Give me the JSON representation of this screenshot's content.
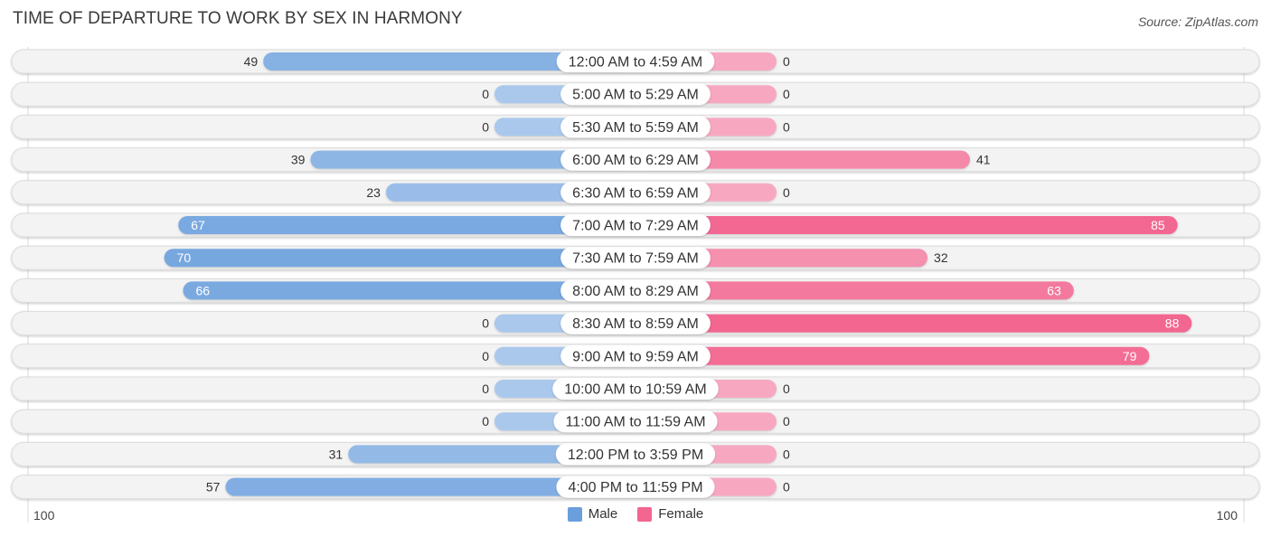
{
  "header": {
    "title": "TIME OF DEPARTURE TO WORK BY SEX IN HARMONY",
    "source": "Source: ZipAtlas.com"
  },
  "colors": {
    "male_strong": "#6a9fdc",
    "male_light": "#aac8ec",
    "female_strong": "#f26690",
    "female_light": "#f7a8c0",
    "row_bg": "#f3f3f3",
    "row_border": "#dcdcdc"
  },
  "legend": {
    "male_label": "Male",
    "female_label": "Female"
  },
  "axis": {
    "left_label": "100",
    "right_label": "100"
  },
  "chart_data": {
    "type": "bar",
    "orientation": "horizontal-diverging",
    "title": "TIME OF DEPARTURE TO WORK BY SEX IN HARMONY",
    "xlabel": "",
    "ylabel": "",
    "xlim": [
      0,
      100
    ],
    "legend_position": "bottom-center",
    "categories": [
      "12:00 AM to 4:59 AM",
      "5:00 AM to 5:29 AM",
      "5:30 AM to 5:59 AM",
      "6:00 AM to 6:29 AM",
      "6:30 AM to 6:59 AM",
      "7:00 AM to 7:29 AM",
      "7:30 AM to 7:59 AM",
      "8:00 AM to 8:29 AM",
      "8:30 AM to 8:59 AM",
      "9:00 AM to 9:59 AM",
      "10:00 AM to 10:59 AM",
      "11:00 AM to 11:59 AM",
      "12:00 PM to 3:59 PM",
      "4:00 PM to 11:59 PM"
    ],
    "series": [
      {
        "name": "Male",
        "values": [
          49,
          0,
          0,
          39,
          23,
          67,
          70,
          66,
          0,
          0,
          0,
          0,
          31,
          57
        ]
      },
      {
        "name": "Female",
        "values": [
          0,
          0,
          0,
          41,
          0,
          85,
          32,
          63,
          88,
          79,
          0,
          0,
          0,
          0
        ]
      }
    ]
  }
}
